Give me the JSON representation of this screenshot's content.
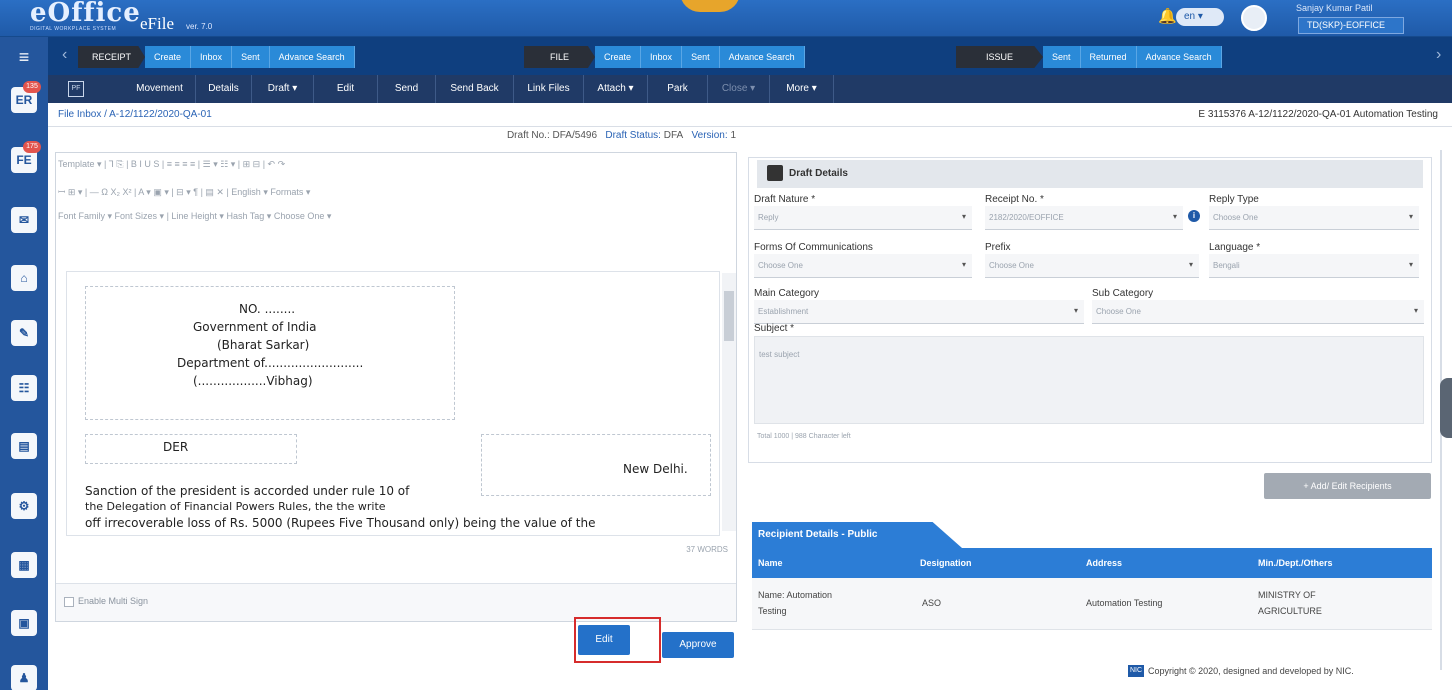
{
  "header": {
    "logo": "eOffice",
    "logo_sub": "DIGITAL WORKPLACE SYSTEM",
    "product": "eFile",
    "version": "ver. 7.0",
    "lang": "en",
    "user_name": "Sanjay Kumar Patil",
    "user_designation": "TD(SKP)-EOFFICE"
  },
  "sidebar": {
    "badges": [
      "135",
      "175"
    ]
  },
  "modules": {
    "receipt": {
      "title": "RECEIPT",
      "items": [
        "Create",
        "Inbox",
        "Sent",
        "Advance Search"
      ]
    },
    "file": {
      "title": "FILE",
      "items": [
        "Create",
        "Inbox",
        "Sent",
        "Advance Search"
      ]
    },
    "issue": {
      "title": "ISSUE",
      "items": [
        "Sent",
        "Returned",
        "Advance Search"
      ]
    }
  },
  "actions": {
    "pf": "PF",
    "items": [
      "Movement",
      "Details",
      "Draft ▾",
      "Edit",
      "Send",
      "Send Back",
      "Link Files",
      "Attach ▾",
      "Park",
      "Close ▾",
      "More ▾"
    ]
  },
  "breadcrumb": {
    "path": "File Inbox / A-12/1122/2020-QA-01",
    "right": "E  3115376   A-12/1122/2020-QA-01   Automation Testing"
  },
  "draft_info": {
    "draft_no_label": "Draft No.:",
    "draft_no": "DFA/5496",
    "status_label": "Draft Status:",
    "status": "DFA",
    "version_label": "Version:",
    "version": "1"
  },
  "toolbar": {
    "row1": "Template   ▾ | Ꞁ  ⎘  |  B   I   U   S  |  ≡   ≡   ≡   ≡  |  ☰ ▾  ☷ ▾  |  ⊞   ⊟  |  ↶   ↷",
    "row2": "ꟷ   ⊞ ▾  |  —   Ω   X₂   X²  |  A ▾   ▣ ▾  |  ⊟ ▾   ¶  |  ▤   ✕  |  English ▾   Formats ▾",
    "row3": "Font Family  ▾   Font Sizes   ▾   |  Line Height  ▾   Hash Tag   ▾   Choose One ▾"
  },
  "document": {
    "no": "NO. ........",
    "govt": "Government of India",
    "bharat": "(Bharat Sarkar)",
    "dept": "Department of..........................",
    "vibhag": "(..................Vibhag)",
    "der": "DER",
    "place": "New Delhi.",
    "body1": "Sanction of the president is accorded under rule 10 of",
    "body2": "the Delegation of Financial Powers Rules, the the write",
    "body3": "off irrecoverable loss of Rs. 5000 (Rupees Five Thousand only) being the value of the"
  },
  "words": "37 WORDS",
  "esign_label": "Enable Multi Sign",
  "buttons": {
    "edit": "Edit",
    "approve": "Approve",
    "add_recipients": "+ Add/ Edit Recipients"
  },
  "draft_details": {
    "title": "Draft Details",
    "fields": {
      "draft_nature": {
        "label": "Draft Nature *",
        "value": "Reply"
      },
      "receipt_no": {
        "label": "Receipt No. *",
        "value": "2182/2020/EOFFICE"
      },
      "reply_type": {
        "label": "Reply Type",
        "value": "Choose One"
      },
      "forms": {
        "label": "Forms Of Communications",
        "value": "Choose One"
      },
      "prefix": {
        "label": "Prefix",
        "value": "Choose One"
      },
      "language": {
        "label": "Language *",
        "value": "Bengali"
      },
      "main_category": {
        "label": "Main Category",
        "value": "Establishment"
      },
      "sub_category": {
        "label": "Sub Category",
        "value": "Choose One"
      }
    },
    "subject_label": "Subject *",
    "subject_value": "test subject",
    "char_left": "Total 1000 | 988 Character left"
  },
  "recipients": {
    "tab": "Recipient Details - Public",
    "headers": [
      "Name",
      "Designation",
      "Address",
      "Min./Dept./Others"
    ],
    "rows": [
      {
        "name_line1": "Name: Automation",
        "name_line2": "Testing",
        "designation": "ASO",
        "address": "Automation Testing",
        "min_line1": "MINISTRY OF",
        "min_line2": "AGRICULTURE"
      }
    ]
  },
  "footer": {
    "copyright": "Copyright © 2020, designed and developed by NIC."
  },
  "colors": {
    "brand": "#1f5aa8",
    "accent": "#2c7dd6",
    "highlight": "#d62c2c"
  }
}
